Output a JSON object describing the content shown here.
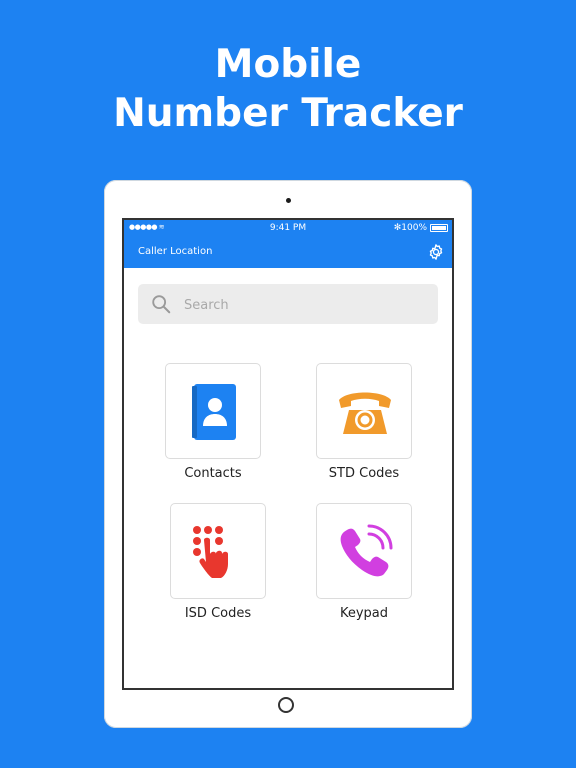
{
  "headline": {
    "line1": "Mobile",
    "line2": "Number Tracker"
  },
  "status_bar": {
    "signal": "●●●●● ≋",
    "time": "9:41 PM",
    "battery": "✻100%"
  },
  "app_bar": {
    "title": "Caller Location",
    "settings_icon": "gear-icon"
  },
  "search": {
    "placeholder": "Search",
    "value": ""
  },
  "menu": [
    {
      "label": "Contacts",
      "icon": "contact-book-icon",
      "color": "#1d82f2"
    },
    {
      "label": "STD Codes",
      "icon": "telephone-icon",
      "color": "#f19a2b"
    },
    {
      "label": "ISD Codes",
      "icon": "keypad-hand-icon",
      "color": "#e8372e"
    },
    {
      "label": "Keypad",
      "icon": "phone-call-icon",
      "color": "#d13fe0"
    }
  ],
  "colors": {
    "brand": "#1d82f2",
    "accent_orange": "#f19a2b",
    "accent_red": "#e8372e",
    "accent_purple": "#d13fe0"
  }
}
